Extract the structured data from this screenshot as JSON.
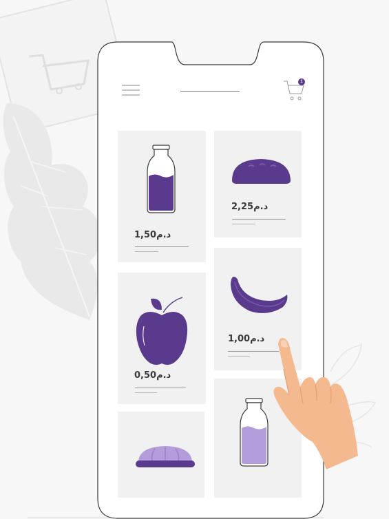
{
  "cart": {
    "count": "1"
  },
  "products": [
    {
      "price": "1,50",
      "currency": "د.م",
      "icon": "milk-bottle-icon"
    },
    {
      "price": "2,25",
      "currency": "د.م",
      "icon": "bread-icon"
    },
    {
      "price": "0,50",
      "currency": "د.م",
      "icon": "apple-icon"
    },
    {
      "price": "1,00",
      "currency": "د.م",
      "icon": "banana-icon"
    },
    {
      "price": "",
      "currency": "",
      "icon": "bun-icon"
    },
    {
      "price": "",
      "currency": "",
      "icon": "milk-bottle-light-icon"
    }
  ],
  "colors": {
    "primary": "#5a3a8c",
    "light": "#b39ddb",
    "card": "#f1f1f1",
    "skin": "#f4b98f"
  }
}
